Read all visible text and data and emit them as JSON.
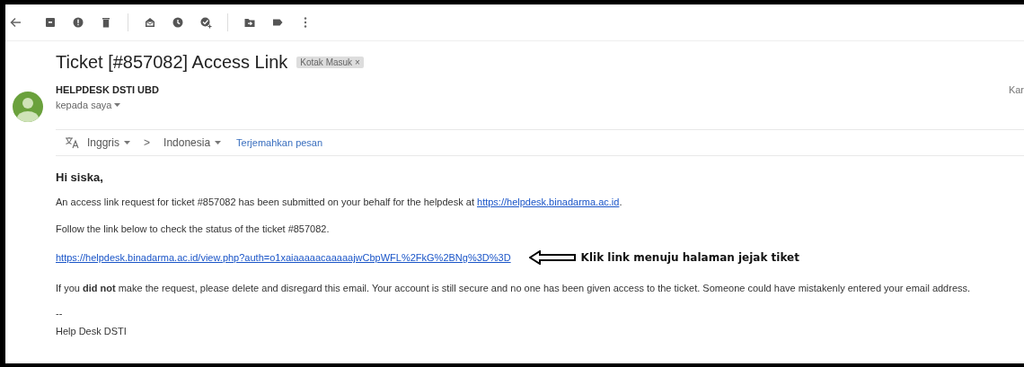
{
  "toolbar": {
    "items": [
      {
        "kind": "back"
      },
      {
        "kind": "archive"
      },
      {
        "kind": "spam"
      },
      {
        "kind": "delete"
      },
      {
        "kind": "separator"
      },
      {
        "kind": "mark-unread"
      },
      {
        "kind": "snooze"
      },
      {
        "kind": "add-task"
      },
      {
        "kind": "separator"
      },
      {
        "kind": "move"
      },
      {
        "kind": "label"
      },
      {
        "kind": "more"
      }
    ]
  },
  "subject": {
    "title": "Ticket [#857082] Access Link",
    "label": {
      "text": "Kotak Masuk",
      "close": "×"
    }
  },
  "sender": {
    "name": "HELPDESK DSTI UBD",
    "recipient": "kepada saya",
    "date": "Kar"
  },
  "translate": {
    "from": "Inggris",
    "arrow": ">",
    "to": "Indonesia",
    "action": "Terjemahkan pesan"
  },
  "body": [
    {
      "kind": "greeting",
      "text": "Hi siska,"
    },
    {
      "kind": "paragraph",
      "text": "An access link request for ticket #857082 has been submitted on your behalf for the helpdesk at ",
      "link": "https://helpdesk.binadarma.ac.id",
      "after": "."
    },
    {
      "kind": "paragraph",
      "text": "Follow the link below to check the status of the ticket #857082."
    },
    {
      "kind": "link",
      "link": "https://helpdesk.binadarma.ac.id/view.php?auth=o1xaiaaaaacaaaaajwCbpWFL%2FkG%2BNg%3D%3D",
      "annotation": "Klik link menuju halaman jejak tiket"
    },
    {
      "kind": "paragraph",
      "text": "If you **did not** make the request, please delete and disregard this email. Your account is still secure and no one has been given access to the ticket. Someone could have mistakenly entered your email address."
    },
    {
      "kind": "signature",
      "lines": [
        "--",
        "Help Desk DSTI"
      ]
    }
  ]
}
